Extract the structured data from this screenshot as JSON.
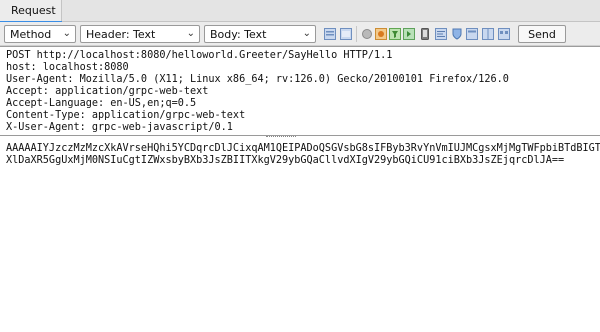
{
  "tabs": [
    {
      "label": "Request"
    }
  ],
  "toolbar": {
    "method": "Method",
    "header": "Header: Text",
    "body": "Body: Text",
    "send_label": "Send"
  },
  "request": {
    "header_lines": [
      "POST http://localhost:8080/helloworld.Greeter/SayHello HTTP/1.1",
      "host: localhost:8080",
      "User-Agent: Mozilla/5.0 (X11; Linux x86_64; rv:126.0) Gecko/20100101 Firefox/126.0",
      "Accept: application/grpc-web-text",
      "Accept-Language: en-US,en;q=0.5",
      "Content-Type: application/grpc-web-text",
      "X-User-Agent: grpc-web-javascript/0.1"
    ],
    "body_lines": [
      "AAAAAIYJzczMzMzcXkAVrseHQhi5YCDqrcDlJCixqAM1QEIPADoQSGVsbG8sIFByb3RvYnVmIUJMCgsxMjMgTWFpbiBTdBIGT",
      "XlDaXR5GgUxMjM0NSIuCgtIZWxsbyBXb3JsZBIITXkgV29ybGQaCllvdXIgV29ybGQiCU91ciBXb3JsZEjqrcDlJA=="
    ]
  }
}
